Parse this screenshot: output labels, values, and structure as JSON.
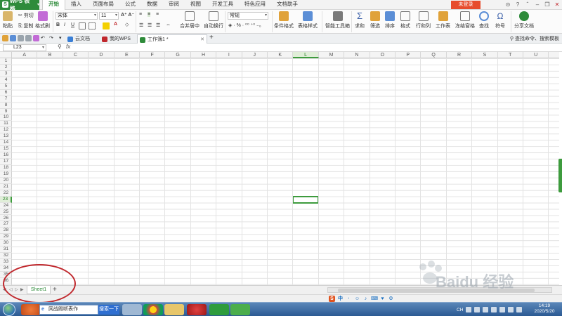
{
  "app": {
    "name": "WPS 表格",
    "login_label": "未登录"
  },
  "menu_tabs": [
    "开始",
    "插入",
    "页面布局",
    "公式",
    "数据",
    "审阅",
    "视图",
    "开发工具",
    "特色应用",
    "文档助手"
  ],
  "ribbon": {
    "paste": "粘贴",
    "cut": "剪切",
    "copy": "复制",
    "format_painter": "格式刷",
    "font_name": "宋体",
    "font_size": "11",
    "merge_center": "合并居中",
    "wrap_text": "自动换行",
    "number_format": "常规",
    "conditional_format": "条件格式",
    "table_style": "表格样式",
    "smart_toolbox": "智能工具箱",
    "sum": "求和",
    "filter": "筛选",
    "sort": "排序",
    "format": "格式",
    "row_col": "行和列",
    "worksheet": "工作表",
    "freeze": "冻结窗格",
    "find": "查找",
    "symbol": "符号",
    "share": "分享文档"
  },
  "doc_tabs": [
    {
      "label": "云文档"
    },
    {
      "label": "我的WPS"
    },
    {
      "label": "工作簿1 *"
    }
  ],
  "command_search": "查找命令、搜索模板",
  "formula_bar": {
    "cell_ref": "L23",
    "fx": "fx"
  },
  "columns": [
    "A",
    "B",
    "C",
    "D",
    "E",
    "F",
    "G",
    "H",
    "I",
    "J",
    "K",
    "L",
    "M",
    "N",
    "O",
    "P",
    "Q",
    "R",
    "S",
    "T",
    "U"
  ],
  "rows": [
    "1",
    "2",
    "3",
    "4",
    "5",
    "6",
    "7",
    "8",
    "9",
    "10",
    "11",
    "12",
    "13",
    "14",
    "15",
    "16",
    "17",
    "18",
    "19",
    "20",
    "21",
    "22",
    "23",
    "24",
    "25",
    "26",
    "27",
    "28",
    "29",
    "30",
    "31",
    "32",
    "33",
    "34",
    "35",
    "36"
  ],
  "selected": {
    "column": "L",
    "row": "23"
  },
  "sheet_tab": "Sheet1",
  "add_sheet": "+",
  "ime_items": [
    "S",
    "中",
    "·",
    "☺",
    "♪",
    "⌨",
    "♥",
    "⚙"
  ],
  "taskbar": {
    "search_text": "网战踢断表作",
    "search_button": "搜索一下",
    "lang": "CH"
  },
  "clock": {
    "time": "14:19",
    "date": "2020/5/20"
  },
  "watermark": "Baidu 经验",
  "colors": {
    "wps_green": "#2e8b3a",
    "selection_green": "#3d9b3d",
    "annotation_red": "#c0282d",
    "login_red": "#e74c2c"
  }
}
